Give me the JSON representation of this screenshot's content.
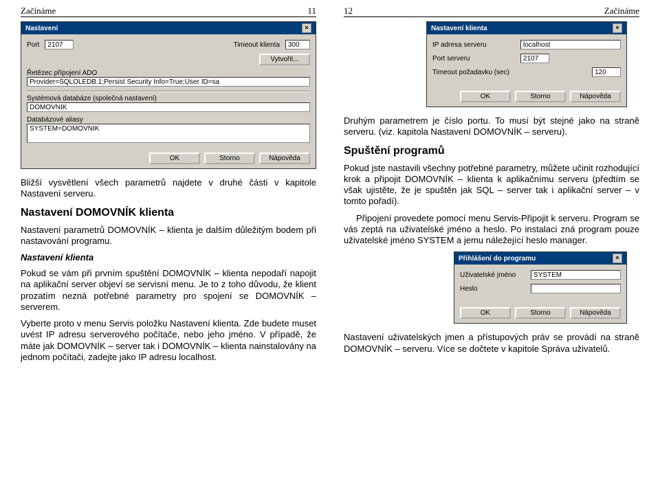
{
  "left": {
    "header_l": "Začínáme",
    "header_r": "11",
    "dialog1": {
      "title": "Nastavení",
      "close": "×",
      "port_label": "Port",
      "port_value": "2107",
      "timeout_label": "Timeout klienta",
      "timeout_value": "300",
      "vytvorit_btn": "Vytvořit...",
      "ado_label": "Řetězec přípojení ADO",
      "ado_value": "Provider=SQLOLEDB.1;Persist Security Info=True;User ID=sa",
      "sysdb_label": "Systémová databáze (společná nastavení)",
      "sysdb_value": "DOMOVNIK",
      "aliasy_label": "Databázové aliasy",
      "aliasy_value": "SYSTEM=DOMOVNIK",
      "ok": "OK",
      "storno": "Storno",
      "napoveda": "Nápověda"
    },
    "p1": "Bližší vysvětlení všech parametrů najdete v druhé části v kapitole Nastavení serveru.",
    "h2": "Nastavení DOMOVNÍK klienta",
    "p2": "Nastavení parametrů DOMOVNÍK – klienta je dalším důležitým bodem při nastavování programu.",
    "h3": "Nastavení klienta",
    "p3": "Pokud se vám při prvním spuštění DOMOVNÍK – klienta nepodaří napojit na aplikační server objeví se servisní menu. Je to z toho důvodu, že klient prozatím nezná potřebné parametry pro spojení se DOMOVNÍK – serverem.",
    "p4": "Vyberte proto v menu Servis položku Nastavení klienta. Zde budete muset uvést IP adresu serverového počítače, nebo jeho jméno. V případě, že máte jak DOMOVNÍK – server tak i DOMOVNÍK – klienta nainstalovány na jednom počítači, zadejte jako IP adresu localhost."
  },
  "right": {
    "header_l": "12",
    "header_r": "Začínáme",
    "dialog2": {
      "title": "Nastavení klienta",
      "close": "×",
      "ip_label": "IP adresa serveru",
      "ip_value": "localhost",
      "port_label": "Port serveru",
      "port_value": "2107",
      "timeout_label": "Timeout požadavku (sec)",
      "timeout_value": "120",
      "ok": "OK",
      "storno": "Storno",
      "napoveda": "Nápověda"
    },
    "p1": "Druhým parametrem je číslo portu. To musí být stejné jako na straně serveru. (viz. kapitola Nastavení DOMOVNÍK – serveru).",
    "h2": "Spuštění programů",
    "p2": "Pokud jste nastavili všechny potřebné parametry, můžete učinit rozhodující krok a připojit DOMOVNÍK – klienta k aplikačnímu serveru (předtím se však ujistěte, že je spuštěn jak SQL – server tak i aplikační server – v tomto pořadí).",
    "p3": "Připojení provedete pomocí menu Servis-Připojit k serveru. Program se vás zeptá na uživatelské jméno a heslo. Po instalaci zná program pouze uživatelské jméno SYSTEM a jemu náležející heslo manager.",
    "dialog3": {
      "title": "Přihlášení do programu",
      "close": "×",
      "user_label": "Uživatelské jméno",
      "user_value": "SYSTEM",
      "pass_label": "Heslo",
      "pass_value": "",
      "ok": "OK",
      "storno": "Storno",
      "napoveda": "Nápověda"
    },
    "p4": "Nastavení uživatelských jmen a přístupových práv se provádí na straně DOMOVNÍK – serveru. Více se dočtete v kapitole Správa uživatelů."
  }
}
